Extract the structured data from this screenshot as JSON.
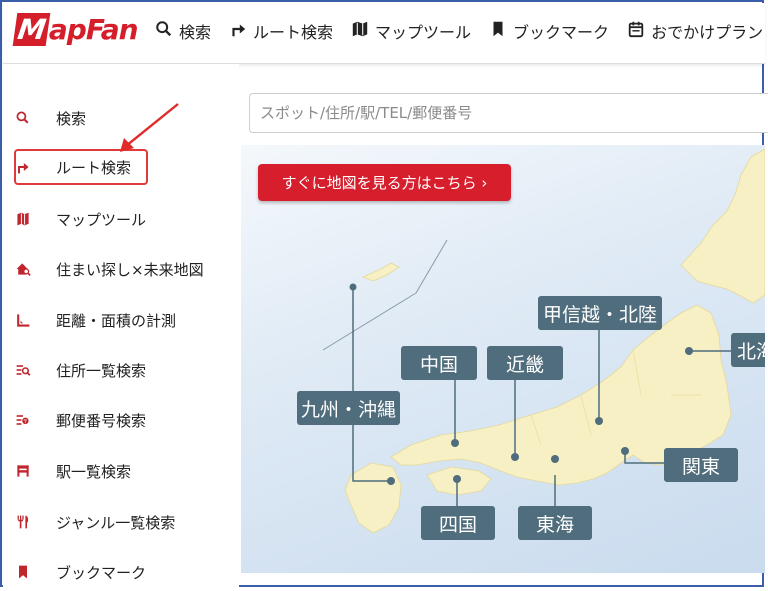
{
  "header": {
    "logo": "MapFan",
    "nav": [
      {
        "label": "検索",
        "icon": "search-icon"
      },
      {
        "label": "ルート検索",
        "icon": "route-arrow-icon"
      },
      {
        "label": "マップツール",
        "icon": "map-icon"
      },
      {
        "label": "ブックマーク",
        "icon": "bookmark-icon"
      },
      {
        "label": "おでかけプラン",
        "icon": "calendar-icon"
      }
    ]
  },
  "sidebar": {
    "items": [
      {
        "label": "検索",
        "icon": "search-icon"
      },
      {
        "label": "ルート検索",
        "icon": "route-arrow-icon"
      },
      {
        "label": "マップツール",
        "icon": "map-icon"
      },
      {
        "label": "住まい探し×未来地図",
        "icon": "house-search-icon"
      },
      {
        "label": "距離・面積の計測",
        "icon": "ruler-triangle-icon"
      },
      {
        "label": "住所一覧検索",
        "icon": "list-search-icon"
      },
      {
        "label": "郵便番号検索",
        "icon": "postal-search-icon"
      },
      {
        "label": "駅一覧検索",
        "icon": "train-icon"
      },
      {
        "label": "ジャンル一覧検索",
        "icon": "fork-knife-icon"
      },
      {
        "label": "ブックマーク",
        "icon": "bookmark-icon"
      }
    ]
  },
  "search": {
    "placeholder": "スポット/住所/駅/TEL/郵便番号"
  },
  "map": {
    "cta_label": "すぐに地図を見る方はこちら ›",
    "regions": [
      "九州・沖縄",
      "中国",
      "近畿",
      "甲信越・北陸",
      "北海",
      "四国",
      "東海",
      "関東"
    ]
  },
  "colors": {
    "brand_red": "#d41f2b",
    "label_bg": "#4f6d7c",
    "land": "#f7f0c4"
  }
}
